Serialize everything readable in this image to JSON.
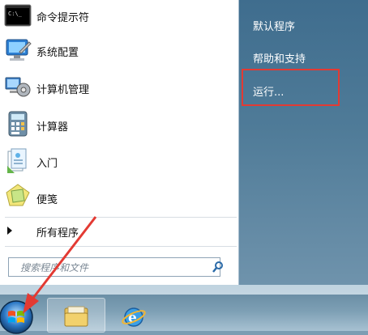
{
  "start_menu": {
    "pinned_items": [
      {
        "label": "命令提示符",
        "icon": "command-prompt-icon"
      },
      {
        "label": "系统配置",
        "icon": "system-config-icon"
      },
      {
        "label": "计算机管理",
        "icon": "computer-management-icon"
      },
      {
        "label": "计算器",
        "icon": "calculator-icon"
      },
      {
        "label": "入门",
        "icon": "getting-started-icon"
      },
      {
        "label": "便笺",
        "icon": "sticky-notes-icon"
      }
    ],
    "all_programs_label": "所有程序",
    "search_placeholder": "搜索程序和文件",
    "right_items": [
      {
        "label": "默认程序"
      },
      {
        "label": "帮助和支持"
      },
      {
        "label": "运行..."
      }
    ]
  },
  "colors": {
    "highlight": "#e33a33",
    "pointer_arrow": "#e33a33"
  }
}
